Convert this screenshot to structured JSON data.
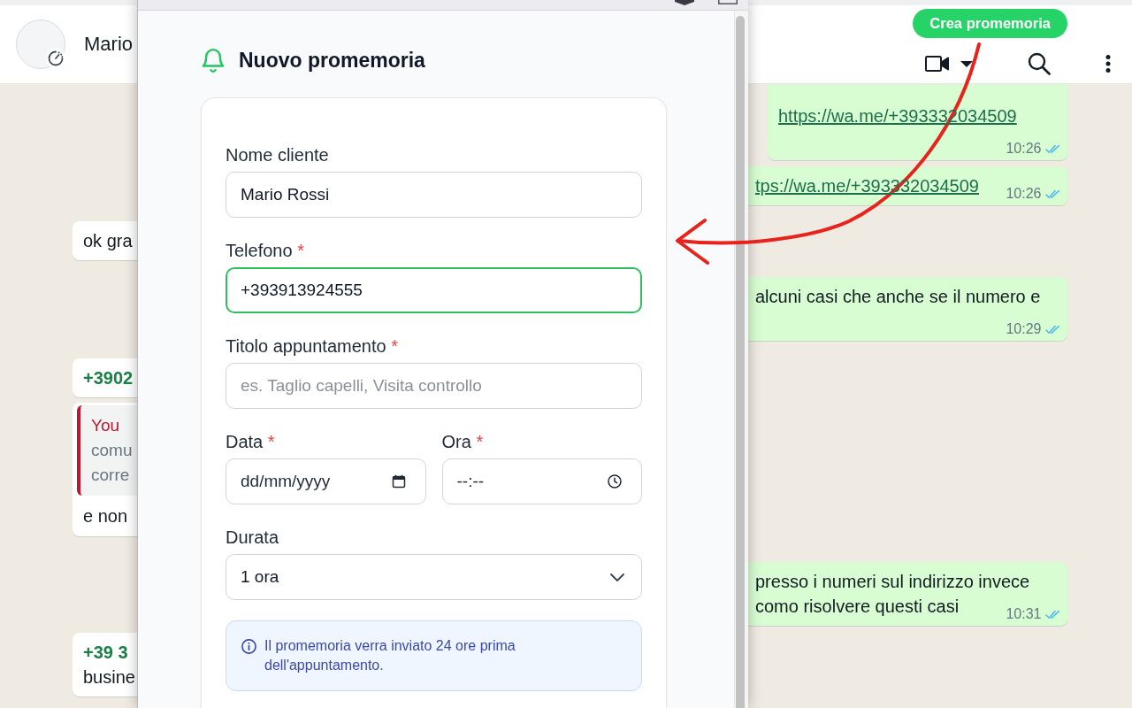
{
  "chat_header": {
    "contact_name": "Mario",
    "reminder_button": "Crea promemoria"
  },
  "incoming_messages": [
    {
      "lines": [
        "ok gra"
      ]
    },
    {
      "sender": "+3902"
    },
    {
      "quote": {
        "author": "You",
        "lines": [
          "comu",
          "corre"
        ]
      },
      "lines": [
        "e non"
      ]
    },
    {
      "sender": "+39 3",
      "lines": [
        "busine"
      ]
    }
  ],
  "outgoing_messages": [
    {
      "kind": "link",
      "lines": [
        "https://wa.me/+393332034509"
      ],
      "time": "10:26",
      "read": true
    },
    {
      "kind": "link",
      "lines": [
        "tps://wa.me/+393332034509"
      ],
      "time": "10:26",
      "read": true
    },
    {
      "kind": "text",
      "lines": [
        "alcuni casi che anche se il numero e"
      ],
      "time": "10:29",
      "read": true
    },
    {
      "kind": "text",
      "lines": [
        "presso i numeri sul indirizzo invece",
        "como risolvere questi casi"
      ],
      "time": "10:31",
      "read": true
    }
  ],
  "popup": {
    "title": "Nuovo promemoria",
    "fields": [
      {
        "kind": "text",
        "label": "Nome cliente",
        "value": "Mario Rossi",
        "focused": false
      },
      {
        "kind": "text",
        "label": "Telefono",
        "required_mark": "*",
        "value": "+393913924555",
        "focused": true
      },
      {
        "kind": "text",
        "label": "Titolo appuntamento",
        "required_mark": "*",
        "placeholder": "es. Taglio capelli, Visita controllo",
        "focused": false
      },
      {
        "kind": "date",
        "label": "Data",
        "required_mark": "*",
        "placeholder": "dd/mm/yyyy",
        "focused": false
      },
      {
        "kind": "time",
        "label": "Ora",
        "required_mark": "*",
        "placeholder": "--:--",
        "focused": false
      },
      {
        "kind": "select",
        "label": "Durata",
        "value": "1 ora",
        "focused": false
      }
    ],
    "info": "Il promemoria verra inviato 24 ore prima dell'appuntamento."
  }
}
